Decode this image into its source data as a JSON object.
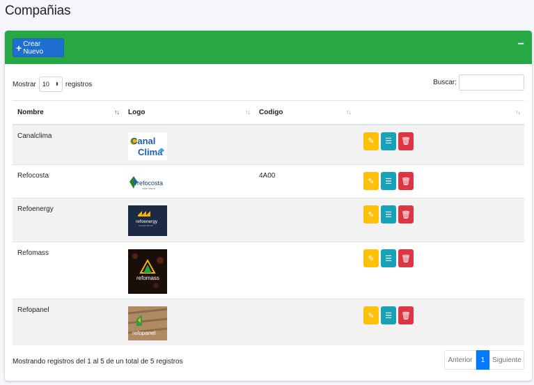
{
  "page": {
    "title": "Compañias"
  },
  "header": {
    "create_label": "Crear Nuevo",
    "collapse": "−",
    "color": "#28a745"
  },
  "controls": {
    "show_label": "Mostrar",
    "page_size": "10",
    "records_label": "registros",
    "search_label": "Buscar:",
    "search_value": ""
  },
  "table": {
    "columns": [
      "Nombre",
      "Logo",
      "Codigo",
      ""
    ],
    "rows": [
      {
        "nombre": "Canalclima",
        "codigo": "",
        "logo": "canalclima-logo"
      },
      {
        "nombre": "Refocosta",
        "codigo": "4A00",
        "logo": "refocosta-logo"
      },
      {
        "nombre": "Refoenergy",
        "codigo": "",
        "logo": "refoenergy-logo"
      },
      {
        "nombre": "Refomass",
        "codigo": "",
        "logo": "refomass-logo"
      },
      {
        "nombre": "Refopanel",
        "codigo": "",
        "logo": "refopanel-logo"
      }
    ],
    "actions": {
      "edit_icon": "pencil-icon",
      "list_icon": "list-icon",
      "delete_icon": "trash-icon"
    }
  },
  "logos": {
    "canalclima": {
      "line1": "Canal",
      "line2": "Clima"
    },
    "refocosta": {
      "name": "refocosta",
      "tagline": "valor natural"
    },
    "refoenergy": {
      "name": "refoenergy",
      "tagline": "energía natural"
    },
    "refomass": {
      "name": "refomass"
    },
    "refopanel": {
      "name": "refopanel"
    }
  },
  "footer": {
    "info": "Mostrando registros del 1 al 5 de un total de 5 registros",
    "prev": "Anterior",
    "current_page": "1",
    "next": "Siguiente"
  }
}
